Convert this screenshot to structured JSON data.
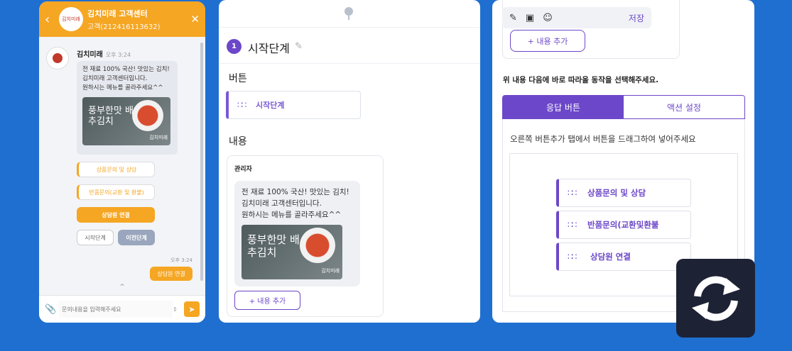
{
  "chat": {
    "header": {
      "title": "김치미래 고객센터",
      "subtitle": "고객(212416113632)",
      "logo_text": "김치미래"
    },
    "sender": "김치미래",
    "sender_time": "오후 3:24",
    "message_lines": [
      "전 재료 100% 국산! 맛있는 김치!",
      "김치미래 고객센터입니다.",
      "원하시는 메뉴를 골라주세요^^"
    ],
    "image_caption": "풍부한맛 배추김치",
    "image_mark": "김치미래",
    "quick_buttons": [
      "상품문의 및 상담",
      "반품문의(교환 및 환불)",
      "상담원 연결",
      "시작단계",
      "이전단계"
    ],
    "reply_time": "오후 3:24",
    "reply_text": "상담원 연결",
    "input_placeholder": "문의내용을 입력해주세요"
  },
  "mid": {
    "step_number": "1",
    "step_title": "시작단계",
    "button_section": "버튼",
    "step_button": "시작단계",
    "content_section": "내용",
    "admin_label": "관리자",
    "message_lines": [
      "전 재료 100% 국산! 맛있는 김치!",
      "김치미래 고객센터입니다.",
      "원하시는 메뉴를 골라주세요^^"
    ],
    "image_caption": "풍부한맛 배추김치",
    "image_mark": "김치미래",
    "add_content": "+ 내용 추가"
  },
  "right": {
    "save": "저장",
    "add_content": "+ 내용 추가",
    "instruction": "위 내용 다음에 바로 따라올 동작을 선택해주세요.",
    "tabs": [
      "응답 버튼",
      "액션 설정"
    ],
    "hint": "오른쪽 버튼추가 탭에서 버튼을 드래그하여 넣어주세요",
    "buttons": [
      "상품문의 및 상담",
      "반품문의(교환및환불",
      "상담원 연결"
    ]
  },
  "colors": {
    "background": "#1f6fd1",
    "chat_accent": "#f5a623",
    "purple": "#6c47c9",
    "sync_bg": "#1e2235"
  }
}
